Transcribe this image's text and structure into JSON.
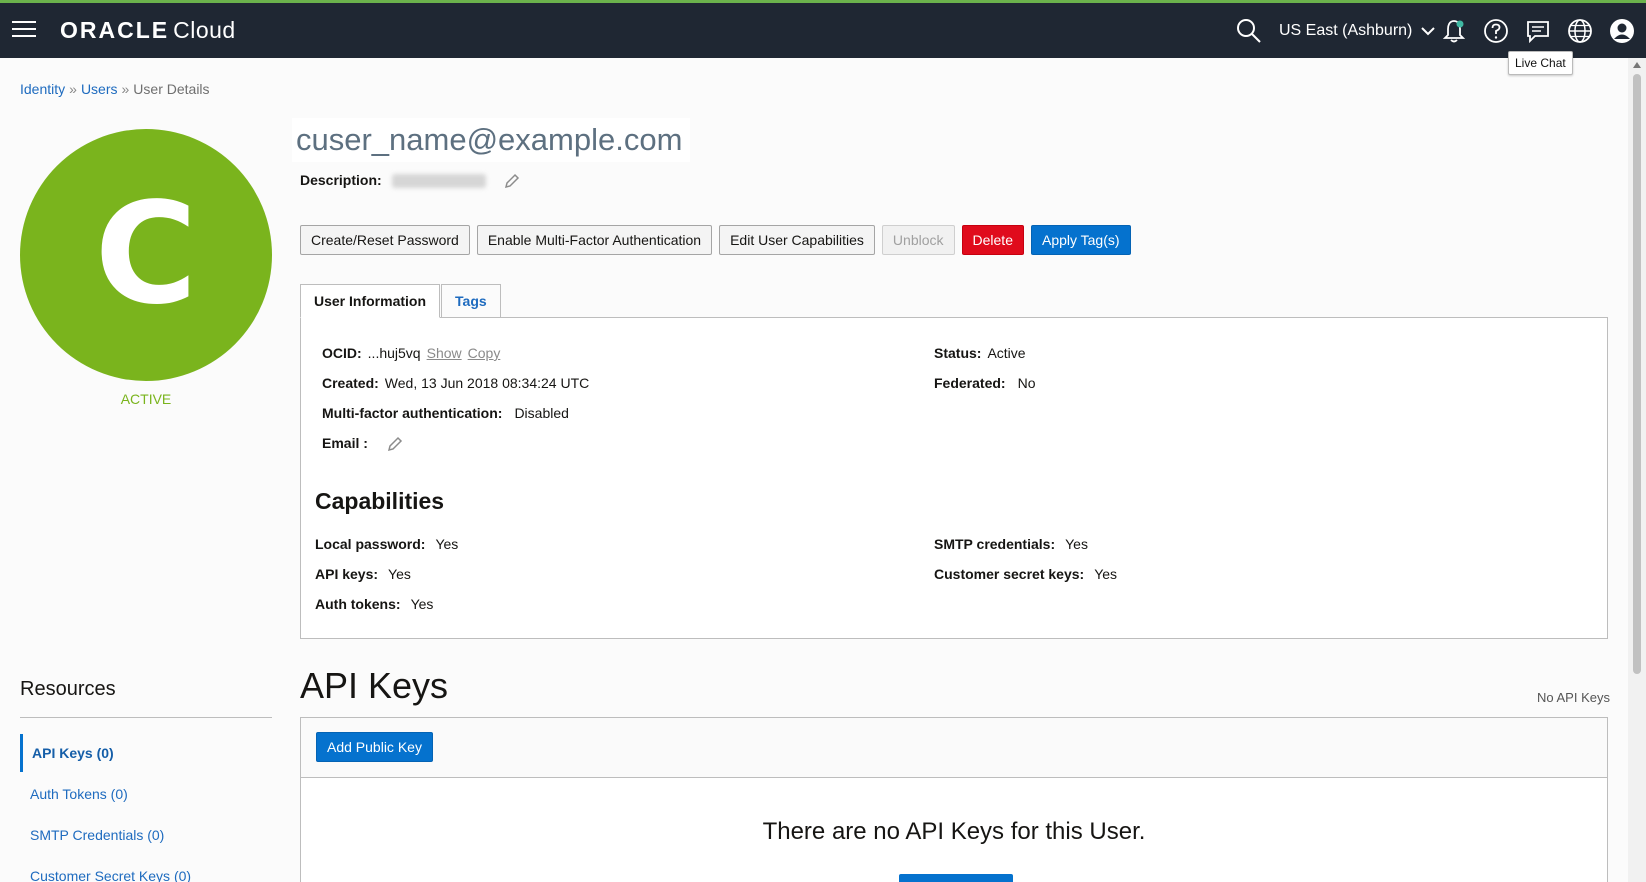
{
  "topbar": {
    "brand_strong": "ORACLE",
    "brand_light": "Cloud",
    "region": "US East (Ashburn)",
    "tooltip": "Live Chat",
    "icons": [
      "menu-icon",
      "search-icon",
      "chevron-down-icon",
      "bell-icon",
      "help-icon",
      "chat-icon",
      "globe-icon",
      "user-icon"
    ]
  },
  "breadcrumb": {
    "items": [
      "Identity",
      "Users"
    ],
    "separator": "»",
    "current": "User Details"
  },
  "user": {
    "avatar_letter": "C",
    "status": "ACTIVE",
    "name": "cuser_name@example.com",
    "description_label": "Description:"
  },
  "actions": {
    "reset_password": "Create/Reset Password",
    "enable_mfa": "Enable Multi-Factor Authentication",
    "edit_capabilities": "Edit User Capabilities",
    "unblock": "Unblock",
    "delete": "Delete",
    "apply_tags": "Apply Tag(s)"
  },
  "tabs": {
    "user_info": "User Information",
    "tags": "Tags"
  },
  "info": {
    "ocid_label": "OCID:",
    "ocid_value": "...huj5vq",
    "show": "Show",
    "copy": "Copy",
    "created_label": "Created:",
    "created_value": "Wed, 13 Jun 2018 08:34:24 UTC",
    "mfa_label": "Multi-factor authentication:",
    "mfa_value": "Disabled",
    "email_label": "Email :",
    "status_label": "Status:",
    "status_value": "Active",
    "federated_label": "Federated:",
    "federated_value": "No"
  },
  "capabilities": {
    "heading": "Capabilities",
    "local_password_label": "Local password:",
    "local_password_value": "Yes",
    "api_keys_label": "API keys:",
    "api_keys_value": "Yes",
    "auth_tokens_label": "Auth tokens:",
    "auth_tokens_value": "Yes",
    "smtp_label": "SMTP credentials:",
    "smtp_value": "Yes",
    "customer_secret_label": "Customer secret keys:",
    "customer_secret_value": "Yes"
  },
  "resources": {
    "title": "Resources",
    "items": [
      "API Keys (0)",
      "Auth Tokens (0)",
      "SMTP Credentials (0)",
      "Customer Secret Keys (0)"
    ]
  },
  "api_keys": {
    "title": "API Keys",
    "count_text": "No API Keys",
    "add_button": "Add Public Key",
    "empty_message": "There are no API Keys for this User."
  },
  "colors": {
    "topbar": "#1f2733",
    "avatar": "#7ab41d",
    "primary": "#0572ce",
    "danger": "#e00b1c",
    "link": "#1e6bbf"
  }
}
